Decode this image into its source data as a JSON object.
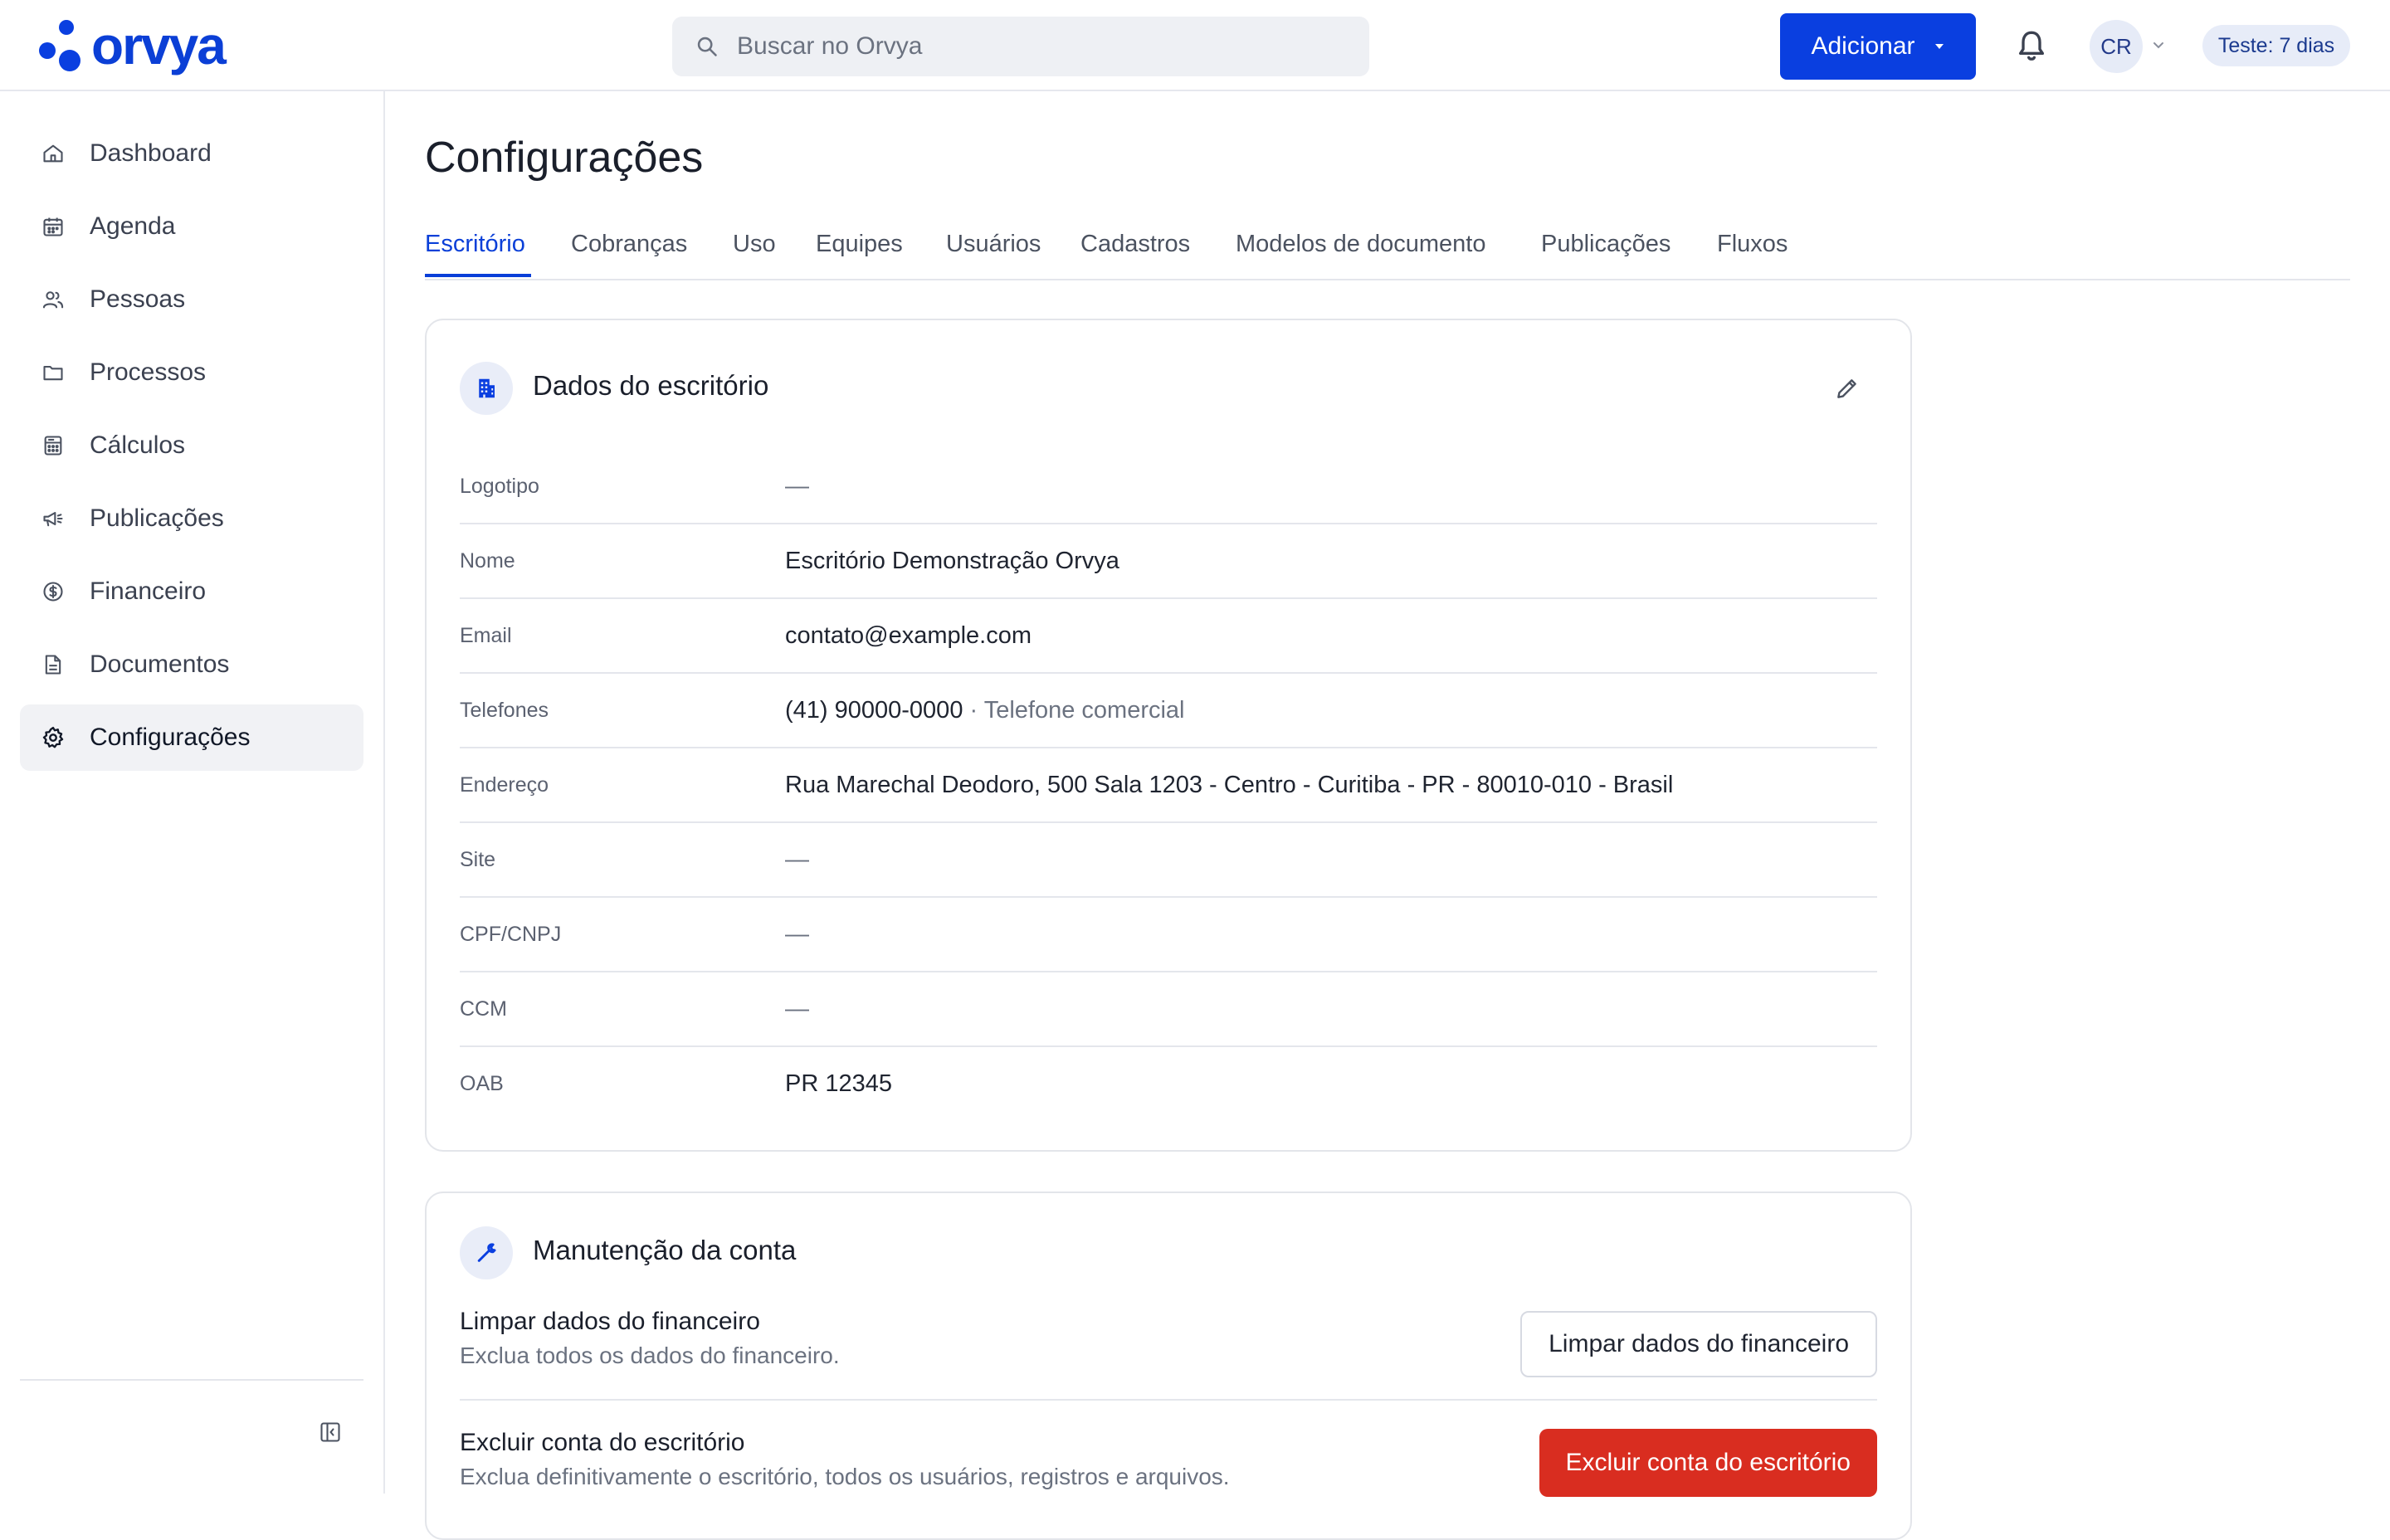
{
  "app": {
    "logo_text": "orvya",
    "brand_color": "#0a3fe0",
    "danger_color": "#d92d20"
  },
  "topbar": {
    "search_placeholder": "Buscar no Orvya",
    "add_label": "Adicionar",
    "avatar_initials": "CR",
    "trial_label": "Teste: 7 dias"
  },
  "sidebar": {
    "items": [
      {
        "label": "Dashboard",
        "icon": "home-icon"
      },
      {
        "label": "Agenda",
        "icon": "calendar-icon"
      },
      {
        "label": "Pessoas",
        "icon": "people-icon"
      },
      {
        "label": "Processos",
        "icon": "folder-icon"
      },
      {
        "label": "Cálculos",
        "icon": "calculator-icon"
      },
      {
        "label": "Publicações",
        "icon": "megaphone-icon"
      },
      {
        "label": "Financeiro",
        "icon": "dollar-icon"
      },
      {
        "label": "Documentos",
        "icon": "document-icon"
      },
      {
        "label": "Configurações",
        "icon": "gear-icon",
        "active": true
      }
    ]
  },
  "main": {
    "title": "Configurações",
    "tabs": [
      {
        "label": "Escritório",
        "active": true
      },
      {
        "label": "Cobranças"
      },
      {
        "label": "Uso"
      },
      {
        "label": "Equipes"
      },
      {
        "label": "Usuários"
      },
      {
        "label": "Cadastros"
      },
      {
        "label": "Modelos de documento"
      },
      {
        "label": "Publicações"
      },
      {
        "label": "Fluxos"
      }
    ],
    "office": {
      "title": "Dados do escritório",
      "fields": [
        {
          "label": "Logotipo",
          "value": "—"
        },
        {
          "label": "Nome",
          "value": "Escritório Demonstração Orvya"
        },
        {
          "label": "Email",
          "value": "contato@example.com"
        },
        {
          "label": "Telefones",
          "value": "(41) 90000-0000",
          "note": "· Telefone comercial"
        },
        {
          "label": "Endereço",
          "value": "Rua Marechal Deodoro, 500 Sala 1203 - Centro - Curitiba - PR - 80010-010 - Brasil"
        },
        {
          "label": "Site",
          "value": "—"
        },
        {
          "label": "CPF/CNPJ",
          "value": "—"
        },
        {
          "label": "CCM",
          "value": "—"
        },
        {
          "label": "OAB",
          "value": "PR 12345"
        }
      ]
    },
    "maintenance": {
      "title": "Manutenção da conta",
      "clear": {
        "title": "Limpar dados do financeiro",
        "desc": "Exclua todos os dados do financeiro.",
        "button": "Limpar dados do financeiro"
      },
      "delete": {
        "title": "Excluir conta do escritório",
        "desc": "Exclua definitivamente o escritório, todos os usuários, registros e arquivos.",
        "button": "Excluir conta do escritório"
      }
    }
  }
}
